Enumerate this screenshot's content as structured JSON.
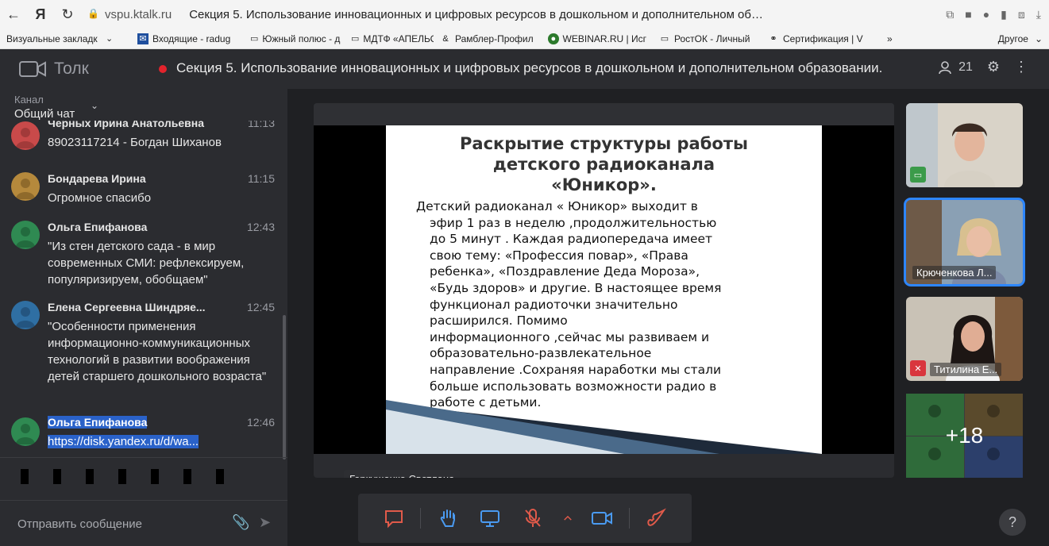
{
  "browser": {
    "domain": "vspu.ktalk.ru",
    "tab_title": "Секция 5. Использование инновационных и цифровых ресурсов в дошкольном и дополнительном об…",
    "bookmarks": [
      {
        "label": "Визуальные закладк",
        "icon": "chevron-down-icon"
      },
      {
        "label": "Входящие - radug",
        "icon": "mail-icon"
      },
      {
        "label": "Южный полюс - д",
        "icon": "page-icon"
      },
      {
        "label": "МДТФ «АПЕЛЬСИ",
        "icon": "page-icon"
      },
      {
        "label": "Рамблер-Профил",
        "icon": "rambler-icon"
      },
      {
        "label": "WEBINAR.RU | Исг",
        "icon": "globe-icon"
      },
      {
        "label": "РостОК - Личный",
        "icon": "page-icon"
      },
      {
        "label": "Сертификация | V",
        "icon": "link-icon"
      }
    ],
    "bookmarks_more": "»",
    "bookmarks_other": "Другое"
  },
  "app": {
    "logo_text": "Толк",
    "conference_title": "Секция 5. Использование инновационных и цифровых ресурсов в дошкольном и дополнительном образовании.",
    "participants_count": "21"
  },
  "sidebar": {
    "channel_label": "Канал",
    "channel_value": "Общий чат",
    "messages": [
      {
        "author": "Черных Ирина Анатольевна",
        "time": "11:13",
        "text": "89023117214 - Богдан Шиханов",
        "avatar_color": "#c94a4a"
      },
      {
        "author": "Бондарева Ирина",
        "time": "11:15",
        "text": "Огромное спасибо",
        "avatar_color": "#b5893c"
      },
      {
        "author": "Ольга Епифанова",
        "time": "12:43",
        "text": "\"Из стен детского сада - в мир современных СМИ: рефлексируем, популяризируем, обобщаем\"",
        "avatar_color": "#2f8a52"
      },
      {
        "author": "Елена Сергеевна Шиндряе...",
        "time": "12:45",
        "text": "\"Особенности применения информационно-коммуникационных технологий в развитии воображения детей старшего дошкольного возраста\"",
        "avatar_color": "#2f6fa3"
      },
      {
        "author": "Ольга Епифанова",
        "time": "12:46",
        "text": "https://disk.yandex.ru/d/wa...",
        "avatar_color": "#2f8a52"
      }
    ],
    "compose_placeholder": "Отправить сообщение"
  },
  "slide": {
    "title_lines": [
      "Раскрытие структуры работы",
      "детского радиоканала",
      "«Юникор»."
    ],
    "body_lines": [
      "Детский радиоканал « Юникор» выходит  в",
      "эфир 1 раз в неделю ,продолжительностью",
      "до 5 минут . Каждая радиопередача имеет",
      "свою тему: «Профессия повар», «Права",
      "ребенка», «Поздравление Деда Мороза»,",
      "«Будь здоров» и другие. В настоящее время",
      "функционал радиоточки значительно",
      "расширился. Помимо",
      "информационного ,сейчас  мы развиваем и",
      "образовательно-развлекательное",
      "направление .Сохраняя наработки мы стали",
      "больше использовать возможности радио  в",
      "работе с детьми."
    ],
    "speaker_name": "Геркушенко Светлана"
  },
  "participants": {
    "tiles": [
      {
        "name": "",
        "badge": "screen-icon",
        "badge_color": "#3b9b4a"
      },
      {
        "name": "Крюченкова Л...",
        "badge": "",
        "badge_color": ""
      },
      {
        "name": "Титилина Е...",
        "badge": "mic-off-icon",
        "badge_color": "#d9363e"
      }
    ],
    "more_label": "+18"
  },
  "controls": {
    "icons": [
      "chat-icon",
      "raise-hand-icon",
      "screen-share-icon",
      "mic-off-icon",
      "chevron-up-icon",
      "camera-icon",
      "hangup-icon"
    ]
  },
  "colors": {
    "accent": "#2d86ff",
    "danger": "#e3232c",
    "selection": "#2a62c9"
  }
}
